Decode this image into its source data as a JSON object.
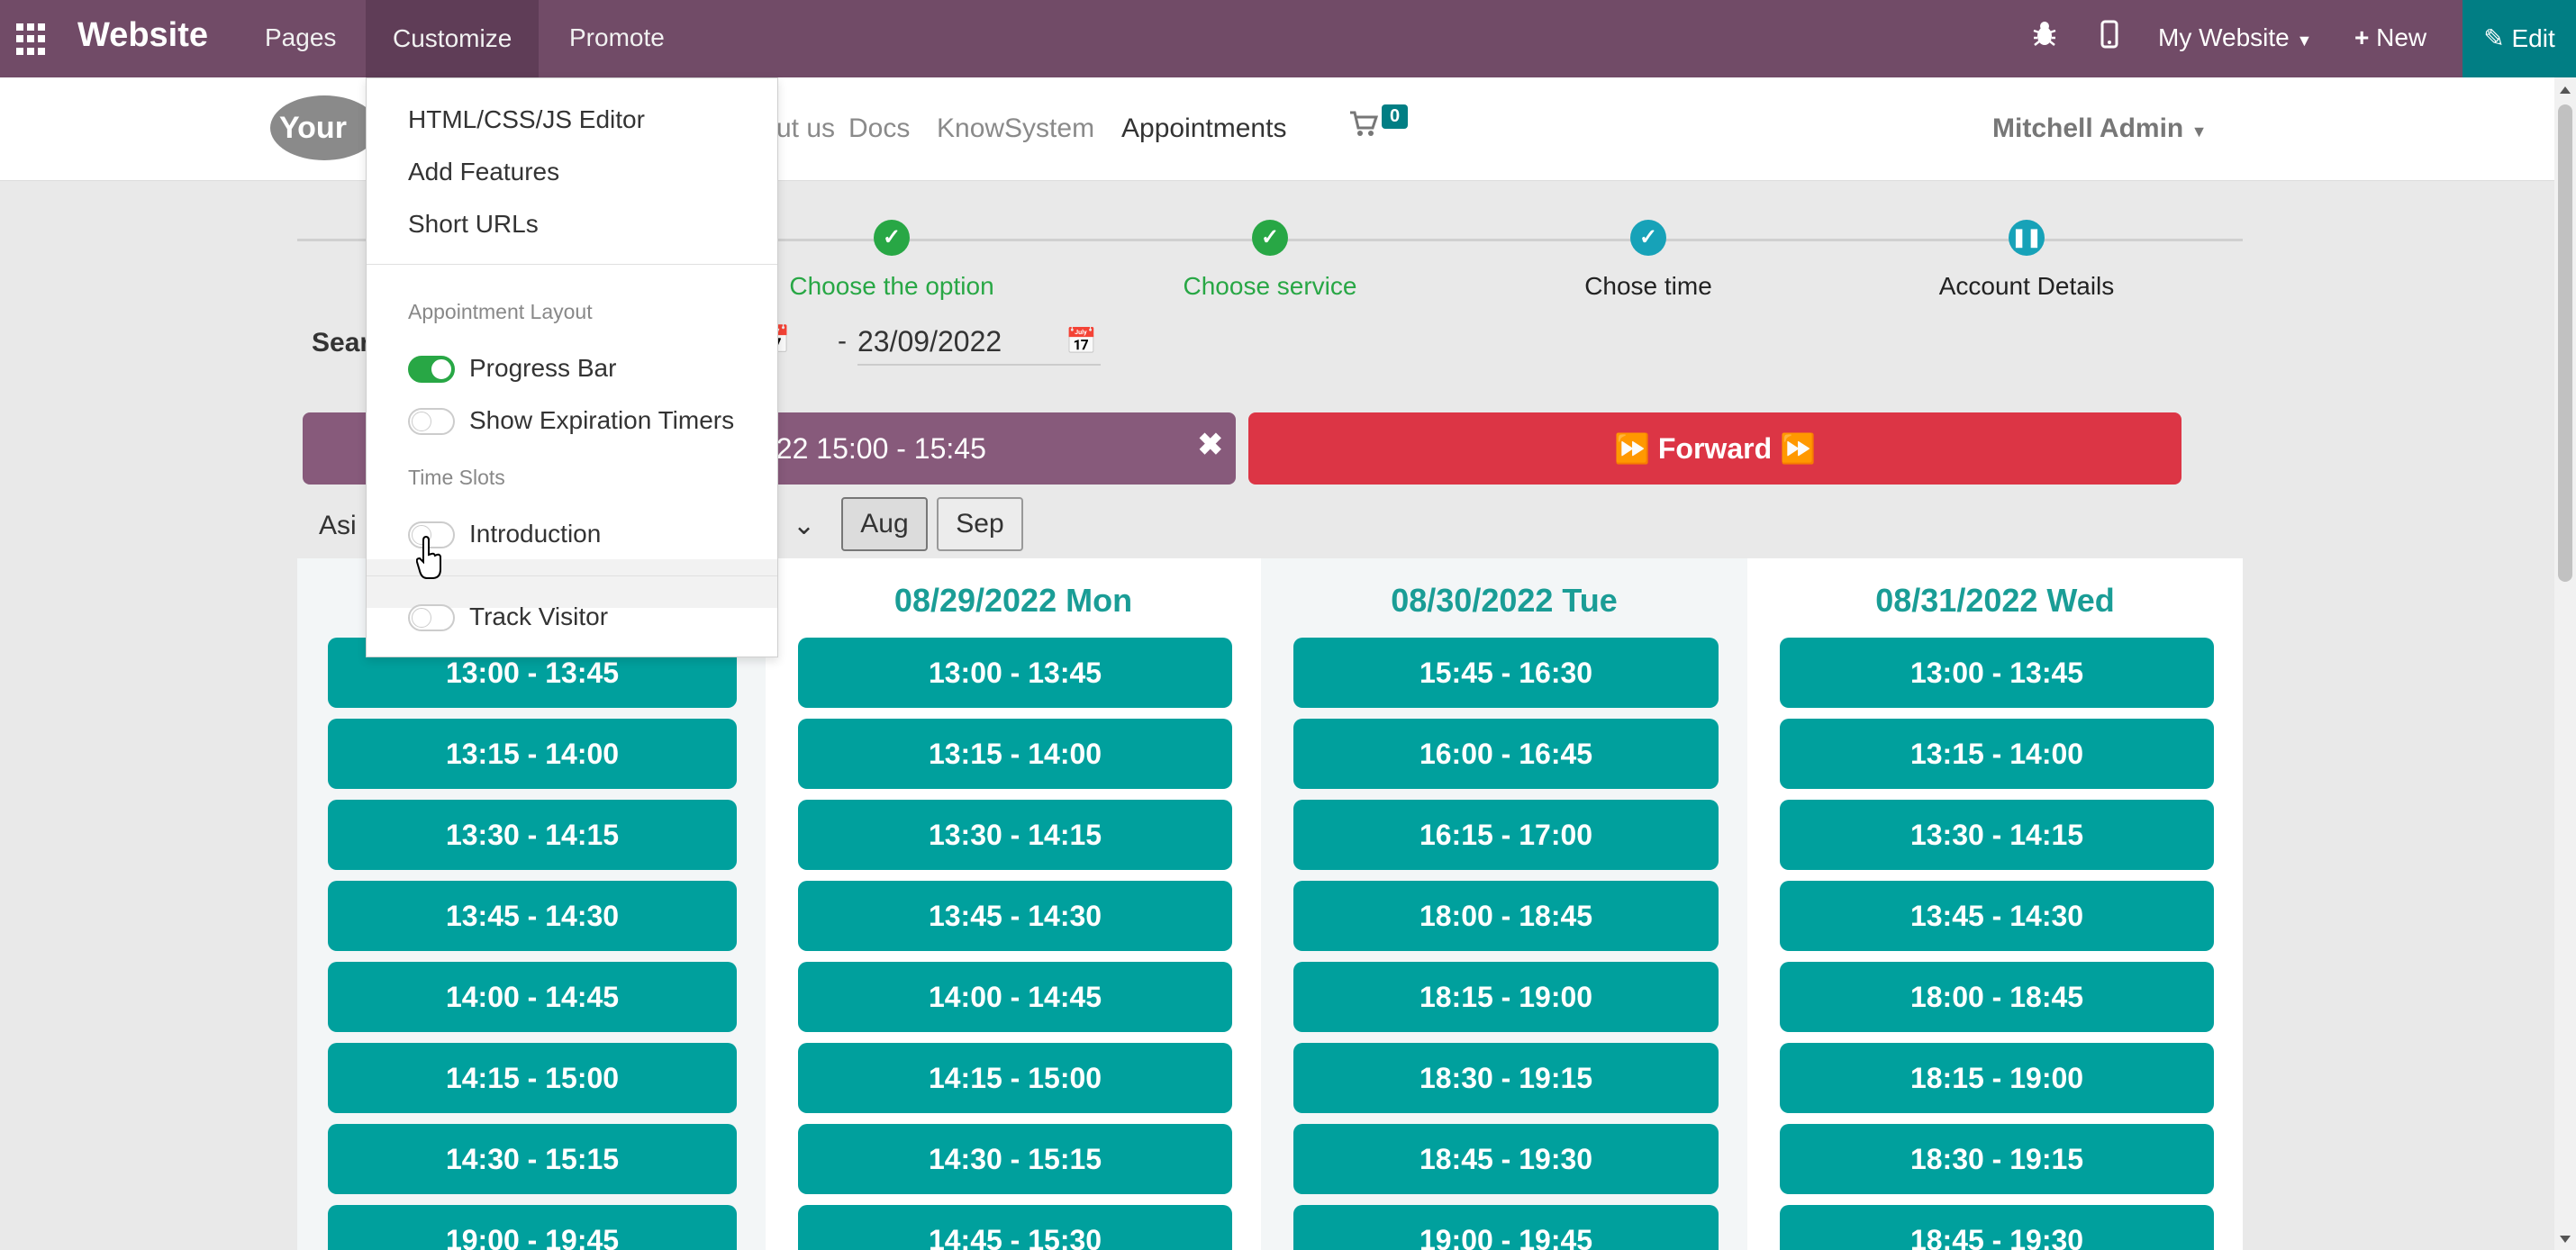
{
  "topbar": {
    "brand": "Website",
    "menu": [
      "Pages",
      "Customize",
      "Promote"
    ],
    "active_menu": "Customize",
    "debug_icon": "bug-icon",
    "mobile_icon": "mobile-icon",
    "site": "My Website",
    "new_label": "New",
    "edit_label": "Edit"
  },
  "site_header": {
    "logo": "Your",
    "nav": [
      "ut us",
      "Docs",
      "KnowSystem",
      "Appointments"
    ],
    "active_nav": "Appointments",
    "cart_count": "0",
    "user": "Mitchell Admin"
  },
  "progress": {
    "steps": [
      {
        "label": "Choose the option",
        "state": "done"
      },
      {
        "label": "Choose service",
        "state": "done"
      },
      {
        "label": "Chose time",
        "state": "current-done"
      },
      {
        "label": "Account Details",
        "state": "current"
      }
    ]
  },
  "search": {
    "label": "Sear",
    "date_to": "23/09/2022",
    "separator": "-"
  },
  "selected_slot": "022 15:00 - 15:45",
  "forward_label": "Forward",
  "timezone": "Asi",
  "months": [
    "Aug",
    "Sep"
  ],
  "columns": [
    {
      "header": "",
      "slots": [
        "13:00 - 13:45",
        "13:15 - 14:00",
        "13:30 - 14:15",
        "13:45 - 14:30",
        "14:00 - 14:45",
        "14:15 - 15:00",
        "14:30 - 15:15",
        "19:00 - 19:45"
      ]
    },
    {
      "header": "08/29/2022 Mon",
      "slots": [
        "13:00 - 13:45",
        "13:15 - 14:00",
        "13:30 - 14:15",
        "13:45 - 14:30",
        "14:00 - 14:45",
        "14:15 - 15:00",
        "14:30 - 15:15",
        "14:45 - 15:30"
      ]
    },
    {
      "header": "08/30/2022 Tue",
      "slots": [
        "15:45 - 16:30",
        "16:00 - 16:45",
        "16:15 - 17:00",
        "18:00 - 18:45",
        "18:15 - 19:00",
        "18:30 - 19:15",
        "18:45 - 19:30",
        "19:00 - 19:45"
      ]
    },
    {
      "header": "08/31/2022 Wed",
      "slots": [
        "13:00 - 13:45",
        "13:15 - 14:00",
        "13:30 - 14:15",
        "13:45 - 14:30",
        "18:00 - 18:45",
        "18:15 - 19:00",
        "18:30 - 19:15",
        "18:45 - 19:30"
      ]
    }
  ],
  "customize_menu": {
    "items": [
      "HTML/CSS/JS Editor",
      "Add Features",
      "Short URLs"
    ],
    "appointment_layout_header": "Appointment Layout",
    "layout_options": [
      {
        "label": "Progress Bar",
        "on": true
      },
      {
        "label": "Show Expiration Timers",
        "on": false
      }
    ],
    "time_slots_header": "Time Slots",
    "time_slot_options": [
      {
        "label": "Introduction",
        "on": false
      }
    ],
    "track_visitor": {
      "label": "Track Visitor",
      "on": false
    }
  },
  "colors": {
    "topbar": "#714b67",
    "slot": "#00a09d",
    "forward": "#dc3545",
    "step_done": "#28a745",
    "step_current": "#17a2b8"
  }
}
